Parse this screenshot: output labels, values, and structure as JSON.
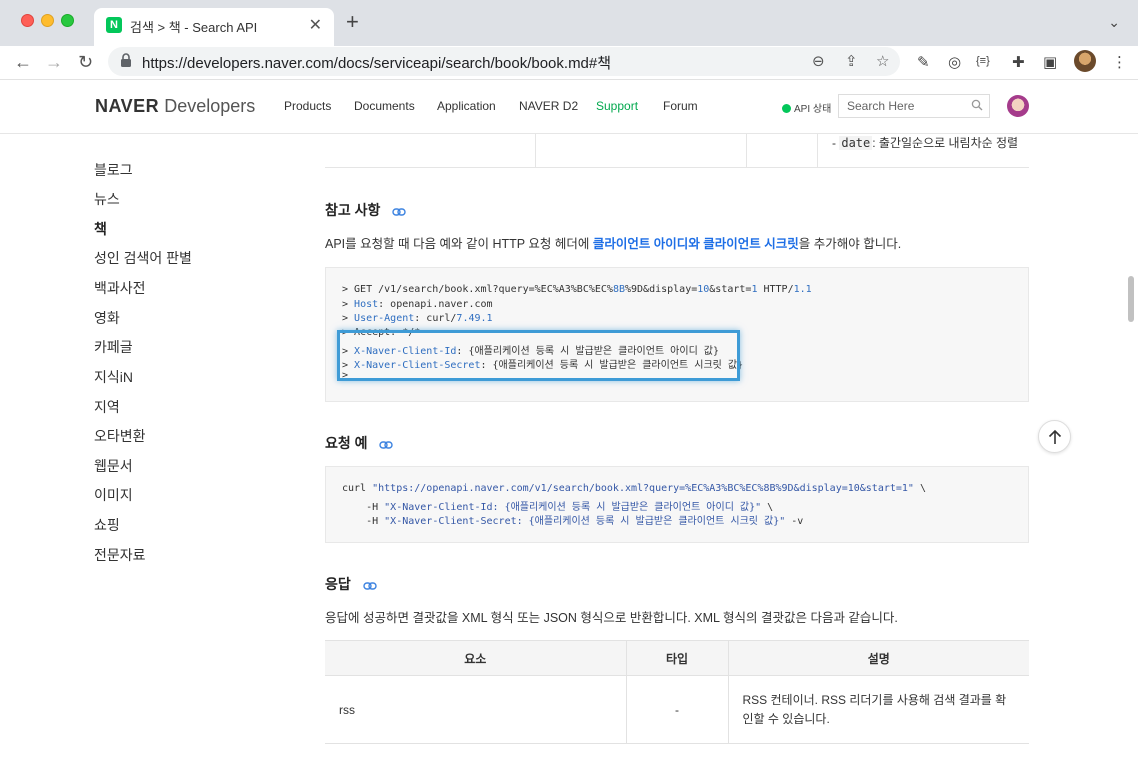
{
  "browser": {
    "tab_favicon": "N",
    "tab_title": "검색 > 책 - Search API",
    "tab_close": "✕",
    "new_tab": "+",
    "tab_menu": "⌄",
    "url": "https://developers.naver.com/docs/serviceapi/search/book/book.md#책",
    "back": "←",
    "forward": "→",
    "reload": "↻",
    "zoom_icon": "⊖",
    "share_icon": "⇪",
    "star_icon": "☆",
    "ext_icons": [
      "✎",
      "◎",
      "{≡}",
      "✚",
      "▣"
    ],
    "menu_icon": "⋮"
  },
  "site": {
    "logo_naver": "NAVER",
    "logo_dev": "Developers",
    "nav": [
      {
        "label": "Products"
      },
      {
        "label": "Documents"
      },
      {
        "label": "Application"
      },
      {
        "label": "NAVER D2"
      },
      {
        "label": "Support"
      },
      {
        "label": "Forum"
      }
    ],
    "api_status": "API 상태",
    "search_placeholder": "Search Here",
    "brand_color": "#03c75a"
  },
  "sidebar": {
    "items": [
      "블로그",
      "뉴스",
      "책",
      "성인 검색어 판별",
      "백과사전",
      "영화",
      "카페글",
      "지식iN",
      "지역",
      "오타변환",
      "웹문서",
      "이미지",
      "쇼핑",
      "전문자료"
    ],
    "current": "책"
  },
  "content": {
    "prev_table": {
      "dash": "-",
      "code": "date",
      "text": ": 출간일순으로 내림차순 정렬"
    },
    "ref_heading": "참고 사항",
    "ref_para": {
      "before": "API를 요청할 때 다음 예와 같이 HTTP 요청 헤더에 ",
      "link1": "클라이언트 아이디",
      "mid": "와 ",
      "link2": "클라이언트 시크릿",
      "after": "을 추가해야 합니다."
    },
    "ref_code": {
      "l1_a": "> GET /v1/search/book.xml?query=%EC%A3%BC%EC%",
      "l1_b": "8B",
      "l1_c": "%9D&display=",
      "l1_d": "10",
      "l1_e": "&start=",
      "l1_f": "1",
      "l1_g": " HTTP/",
      "l1_h": "1.1",
      "l2_a": "> ",
      "l2_b": "Host",
      "l2_c": ": openapi.naver.com",
      "l3_a": "> ",
      "l3_b": "User-Agent",
      "l3_c": ": curl/",
      "l3_d": "7.49.1",
      "l4": "> Accept: */*",
      "l5_a": "> ",
      "l5_b": "X-Naver-Client-Id",
      "l5_c": ": {애플리케이션 등록 시 발급받은 클라이언트 아이디 값}",
      "l6_a": "> ",
      "l6_b": "X-Naver-Client-Secret",
      "l6_c": ": {애플리케이션 등록 시 발급받은 클라이언트 시크릿 값}",
      "l7": ">"
    },
    "example_heading": "요청 예",
    "example_code": {
      "l1_a": "curl ",
      "l1_b": "\"https://openapi.naver.com/v1/search/book.xml?query=%EC%A3%BC%EC%8B%9D&display=10&start=1\"",
      "l1_c": " \\",
      "l2_a": "    -H ",
      "l2_b": "\"X-Naver-Client-Id: {애플리케이션 등록 시 발급받은 클라이언트 아이디 값}\"",
      "l2_c": " \\",
      "l3_a": "    -H ",
      "l3_b": "\"X-Naver-Client-Secret: {애플리케이션 등록 시 발급받은 클라이언트 시크릿 값}\"",
      "l3_c": " -v"
    },
    "response_heading": "응답",
    "response_para": "응답에 성공하면 결괏값을 XML 형식 또는 JSON 형식으로 반환합니다. XML 형식의 결괏값은 다음과 같습니다.",
    "response_table": {
      "headers": [
        "요소",
        "타입",
        "설명"
      ],
      "rows": [
        {
          "name": "rss",
          "type": "-",
          "desc": "RSS 컨테이너. RSS 리더기를 사용해 검색 결과를 확인할 수 있습니다."
        }
      ]
    }
  }
}
